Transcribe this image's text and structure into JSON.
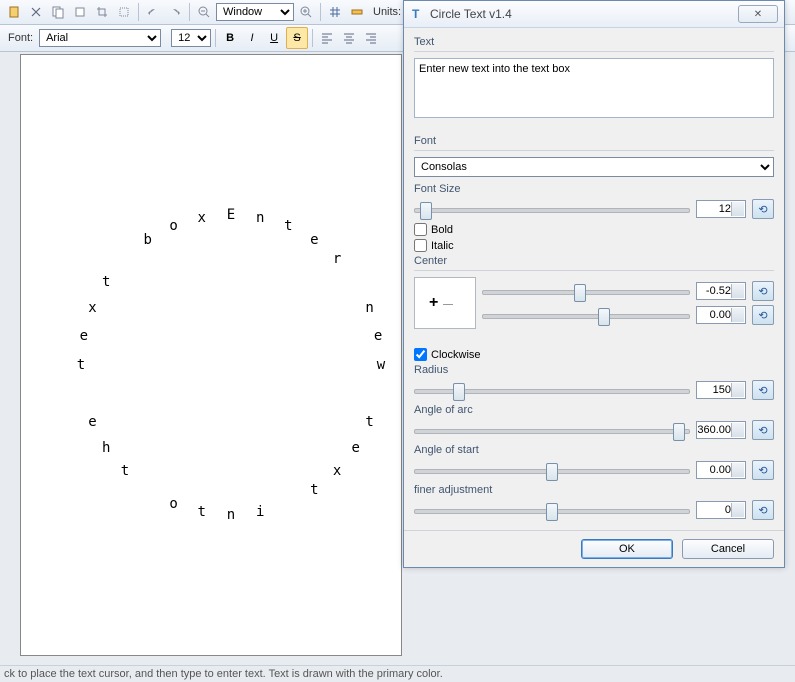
{
  "toolbar": {
    "zoom_mode": "Window",
    "units_label": "Units:",
    "font_label": "Font:",
    "font_family": "Arial",
    "font_size": "12"
  },
  "dialog": {
    "title": "Circle Text v1.4",
    "text_label": "Text",
    "text_value": "Enter new text into the text box",
    "font_label": "Font",
    "font_value": "Consolas",
    "fontsize_label": "Font Size",
    "fontsize_value": "12",
    "bold_label": "Bold",
    "bold_checked": false,
    "italic_label": "Italic",
    "italic_checked": false,
    "center_label": "Center",
    "center_x": "-0.52",
    "center_y": "0.00",
    "clockwise_label": "Clockwise",
    "clockwise_checked": true,
    "radius_label": "Radius",
    "radius_value": "150",
    "angle_arc_label": "Angle of arc",
    "angle_arc_value": "360.00",
    "angle_start_label": "Angle of start",
    "angle_start_value": "0.00",
    "finer_label": "finer adjustment",
    "finer_value": "0",
    "ok": "OK",
    "cancel": "Cancel"
  },
  "status_text": "ck to place the text cursor, and then type to enter text. Text is drawn with the primary color.",
  "theme": {
    "accent": "#3a78c0"
  }
}
